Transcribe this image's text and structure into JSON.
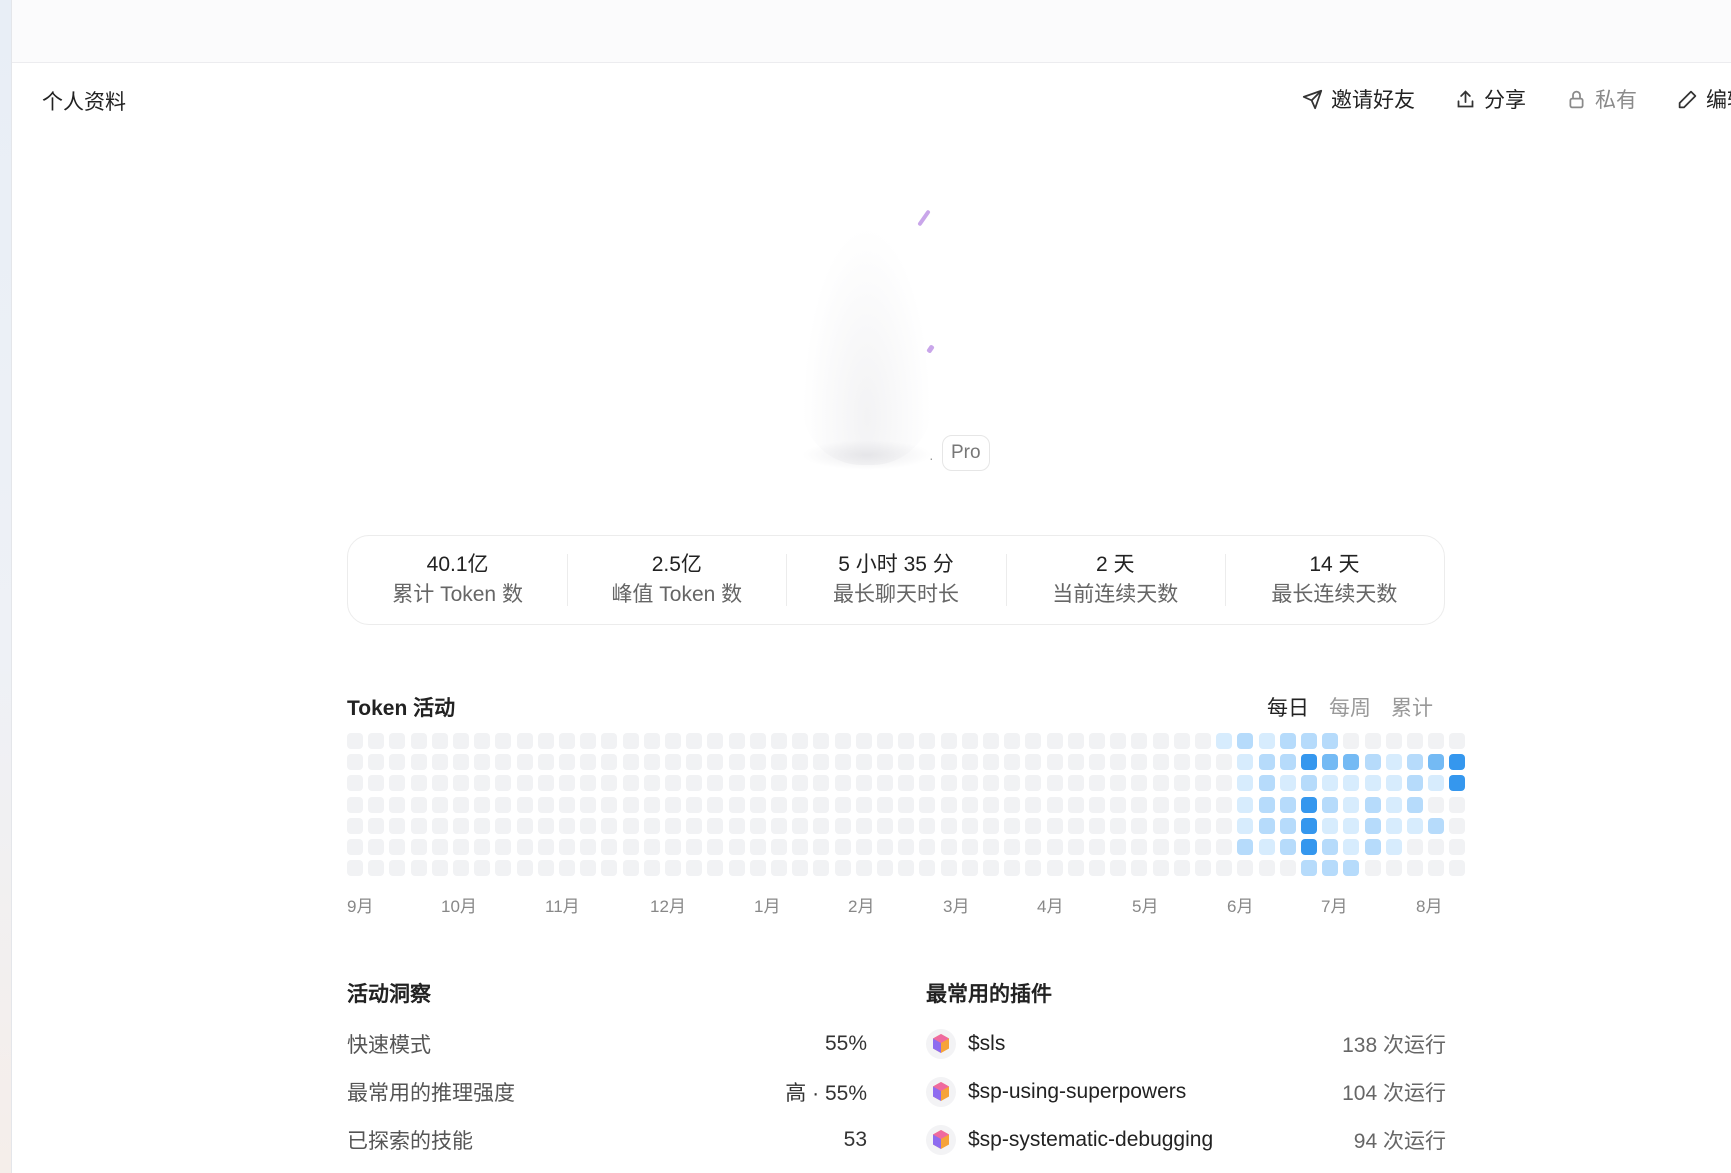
{
  "header": {
    "title": "个人资料",
    "actions": [
      {
        "label": "邀请好友",
        "icon": "send-icon"
      },
      {
        "label": "分享",
        "icon": "upload-icon"
      },
      {
        "label": "私有",
        "icon": "lock-icon"
      },
      {
        "label": "编辑",
        "icon": "pencil-icon"
      }
    ]
  },
  "profile": {
    "plan": "Pro"
  },
  "stats": [
    {
      "value": "40.1亿",
      "label": "累计 Token 数"
    },
    {
      "value": "2.5亿",
      "label": "峰值 Token 数"
    },
    {
      "value": "5 小时 35 分",
      "label": "最长聊天时长"
    },
    {
      "value": "2 天",
      "label": "当前连续天数"
    },
    {
      "value": "14 天",
      "label": "最长连续天数"
    }
  ],
  "activity": {
    "title": "Token 活动",
    "tabs": [
      "每日",
      "每周",
      "累计"
    ],
    "active_tab": "每日",
    "months": [
      "9月",
      "10月",
      "11月",
      "12月",
      "1月",
      "2月",
      "3月",
      "4月",
      "5月",
      "6月",
      "7月",
      "8月"
    ],
    "colors": {
      "0": "#f1f2f4",
      "1": "#d7ecfd",
      "2": "#b6dbfb",
      "3": "#74baf4",
      "4": "#3597ee"
    },
    "weeks_total": 53,
    "active_weeks": [
      [
        1,
        0,
        0,
        0,
        0,
        0,
        0
      ],
      [
        2,
        1,
        1,
        1,
        1,
        2,
        0
      ],
      [
        1,
        2,
        2,
        2,
        2,
        1,
        0
      ],
      [
        2,
        2,
        1,
        2,
        2,
        2,
        0
      ],
      [
        2,
        4,
        2,
        4,
        4,
        4,
        2
      ],
      [
        2,
        3,
        1,
        2,
        1,
        2,
        2
      ],
      [
        0,
        3,
        1,
        1,
        1,
        1,
        2
      ],
      [
        0,
        2,
        1,
        2,
        2,
        2,
        0
      ],
      [
        0,
        1,
        1,
        1,
        1,
        1,
        0
      ],
      [
        0,
        2,
        2,
        2,
        1,
        0,
        0
      ],
      [
        0,
        3,
        1,
        0,
        2,
        0,
        0
      ],
      [
        0,
        4,
        4,
        0,
        0,
        0,
        0
      ]
    ]
  },
  "insights": {
    "title": "活动洞察",
    "rows": [
      {
        "label": "快速模式",
        "value": "55%"
      },
      {
        "label": "最常用的推理强度",
        "value": "高 · 55%"
      },
      {
        "label": "已探索的技能",
        "value": "53"
      }
    ]
  },
  "plugins": {
    "title": "最常用的插件",
    "rows": [
      {
        "name": "$sls",
        "runs": "138 次运行"
      },
      {
        "name": "$sp-using-superpowers",
        "runs": "104 次运行"
      },
      {
        "name": "$sp-systematic-debugging",
        "runs": "94 次运行"
      }
    ]
  }
}
